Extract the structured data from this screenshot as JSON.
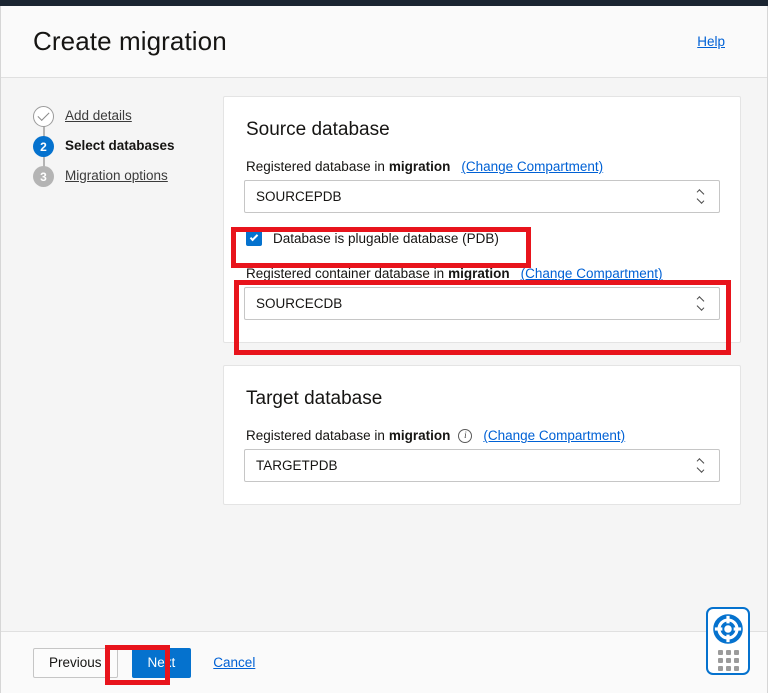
{
  "window": {
    "title": "Create migration",
    "help_label": "Help"
  },
  "steps": [
    {
      "badge": "✓",
      "label": "Add details",
      "state": "done"
    },
    {
      "badge": "2",
      "label": "Select databases",
      "state": "current"
    },
    {
      "badge": "3",
      "label": "Migration options",
      "state": "pending"
    }
  ],
  "source_card": {
    "title": "Source database",
    "db_label_prefix": "Registered database in",
    "db_label_bold": "migration",
    "change_compartment_link": "(Change Compartment)",
    "db_value": "SOURCEPDB",
    "pdb_checkbox_label": "Database is plugable database (PDB)",
    "pdb_checkbox_checked": true,
    "cdb_label_prefix": "Registered container database in",
    "cdb_label_bold": "migration",
    "cdb_change_compartment_link": "(Change Compartment)",
    "cdb_value": "SOURCECDB"
  },
  "target_card": {
    "title": "Target database",
    "db_label_prefix": "Registered database in",
    "db_label_bold": "migration",
    "info_icon": "i",
    "change_compartment_link": "(Change Compartment)",
    "db_value": "TARGETPDB"
  },
  "footer": {
    "previous_label": "Previous",
    "next_label": "Next",
    "cancel_label": "Cancel"
  },
  "help_widget": {
    "icon": "lifebuoy-icon",
    "handle": "drag-handle-dots"
  },
  "colors": {
    "accent_blue": "#0572ce",
    "link_blue": "#0061d5",
    "annotation_red": "#e8141c",
    "top_strip": "#1b2531",
    "body_background": "#f5f5f5"
  }
}
